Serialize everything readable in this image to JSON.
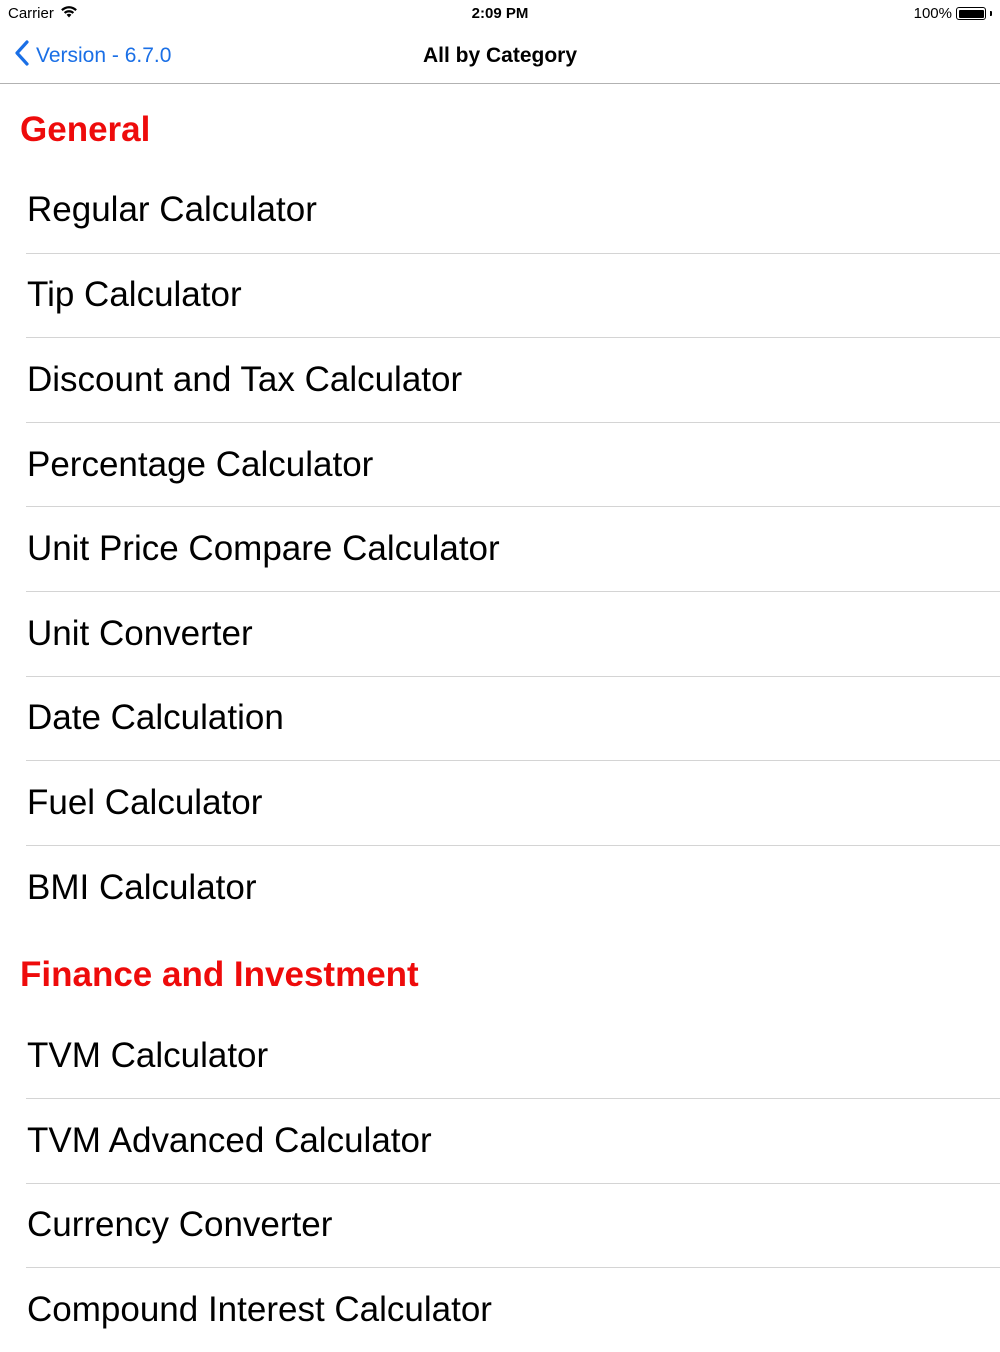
{
  "status_bar": {
    "carrier": "Carrier",
    "time": "2:09 PM",
    "battery_percent_text": "100%",
    "battery_level": 1.0
  },
  "nav": {
    "back_label": "Version - 6.7.0",
    "title": "All by Category",
    "accent_color": "#1a6fe6"
  },
  "section_color": "#ee0b0b",
  "sections": [
    {
      "title": "General",
      "items": [
        "Regular Calculator",
        "Tip Calculator",
        "Discount and Tax Calculator",
        "Percentage Calculator",
        "Unit Price Compare Calculator",
        "Unit Converter",
        "Date Calculation",
        "Fuel Calculator",
        "BMI Calculator"
      ]
    },
    {
      "title": "Finance and Investment",
      "items": [
        "TVM Calculator",
        "TVM Advanced Calculator",
        "Currency Converter",
        "Compound Interest Calculator"
      ]
    }
  ]
}
